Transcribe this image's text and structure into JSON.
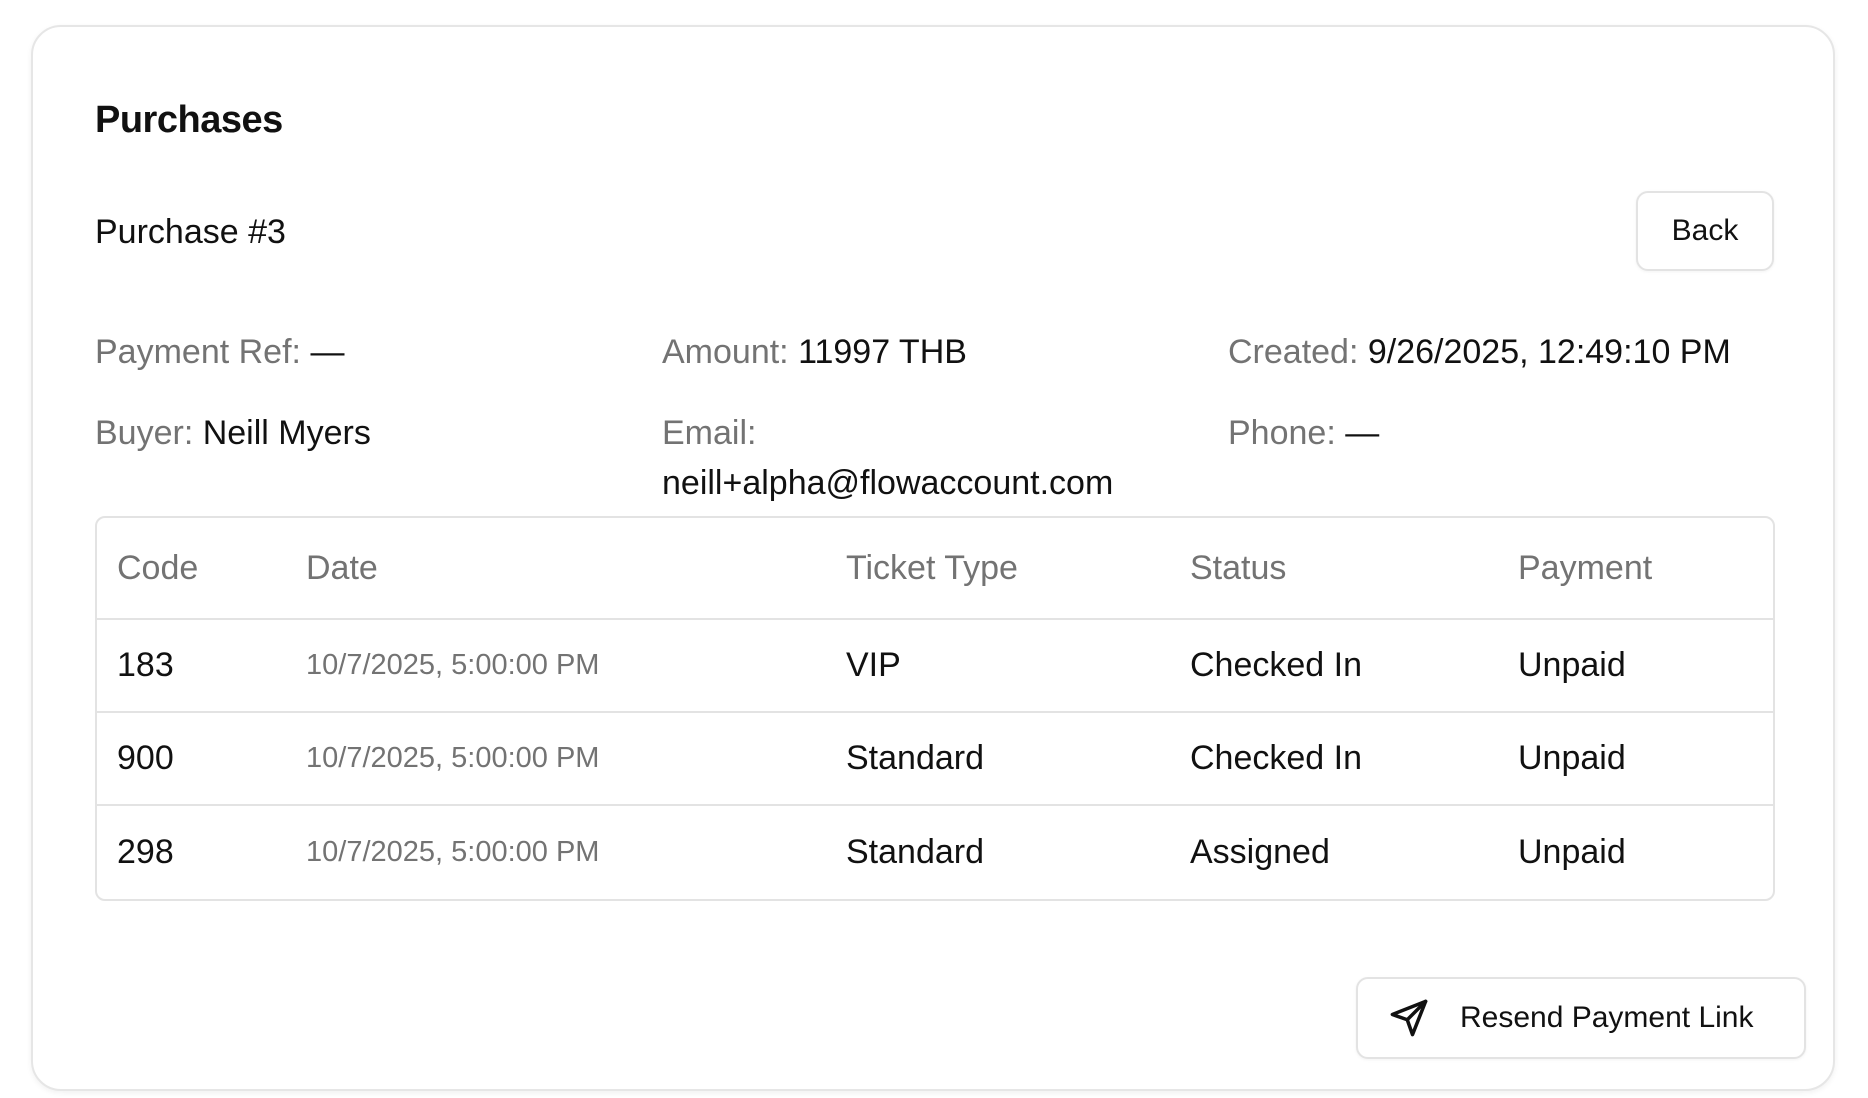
{
  "page_title": "Purchases",
  "purchase": {
    "title": "Purchase #3",
    "back_label": "Back",
    "fields": {
      "payment_ref": {
        "label": "Payment Ref:",
        "value": "—"
      },
      "amount": {
        "label": "Amount:",
        "value": "11997 THB"
      },
      "created": {
        "label": "Created:",
        "value": "9/26/2025, 12:49:10 PM"
      },
      "buyer": {
        "label": "Buyer:",
        "value": "Neill Myers"
      },
      "email": {
        "label": "Email:",
        "value": "neill+alpha@flowaccount.com"
      },
      "phone": {
        "label": "Phone:",
        "value": "—"
      }
    }
  },
  "table": {
    "columns": [
      "Code",
      "Date",
      "Ticket Type",
      "Status",
      "Payment"
    ],
    "rows": [
      {
        "code": "183",
        "date": "10/7/2025, 5:00:00 PM",
        "ticket_type": "VIP",
        "status": "Checked In",
        "payment": "Unpaid"
      },
      {
        "code": "900",
        "date": "10/7/2025, 5:00:00 PM",
        "ticket_type": "Standard",
        "status": "Checked In",
        "payment": "Unpaid"
      },
      {
        "code": "298",
        "date": "10/7/2025, 5:00:00 PM",
        "ticket_type": "Standard",
        "status": "Assigned",
        "payment": "Unpaid"
      }
    ]
  },
  "actions": {
    "resend_label": "Resend Payment Link",
    "resend_icon": "send-icon"
  }
}
